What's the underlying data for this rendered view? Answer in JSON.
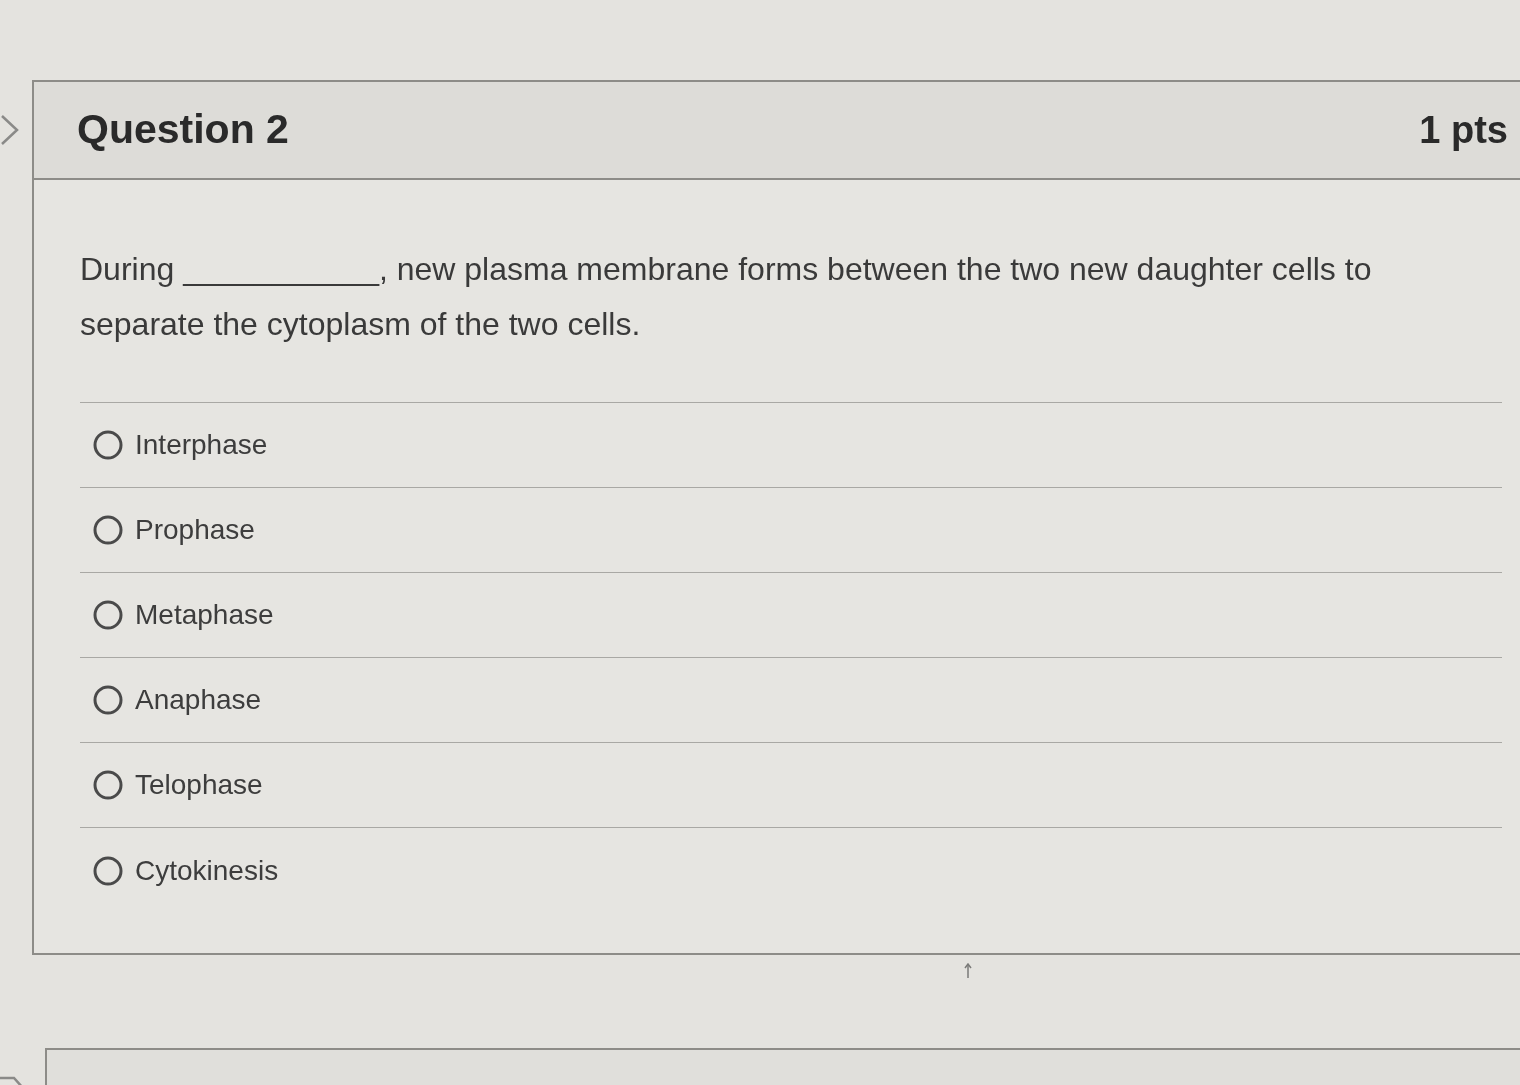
{
  "question": {
    "title": "Question 2",
    "points": "1 pts",
    "text": "During ___________, new plasma membrane forms between the two new daughter cells to separate the cytoplasm of the two cells.",
    "answers": [
      {
        "label": "Interphase",
        "selected": false
      },
      {
        "label": "Prophase",
        "selected": false
      },
      {
        "label": "Metaphase",
        "selected": false
      },
      {
        "label": "Anaphase",
        "selected": false
      },
      {
        "label": "Telophase",
        "selected": false
      },
      {
        "label": "Cytokinesis",
        "selected": false
      }
    ]
  }
}
